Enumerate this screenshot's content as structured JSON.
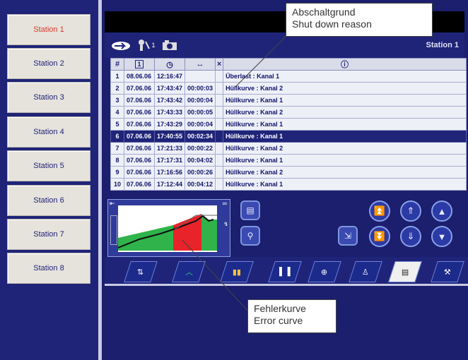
{
  "sidebar": {
    "stations": [
      "Station 1",
      "Station 2",
      "Station 3",
      "Station 4",
      "Station 5",
      "Station 6",
      "Station 7",
      "Station 8"
    ]
  },
  "header": {
    "station_label": "Station 1",
    "superscript": "1"
  },
  "table": {
    "columns": [
      "#",
      "1",
      "clock",
      "↔",
      "×",
      "ⓘ"
    ],
    "rows": [
      {
        "no": "1",
        "date": "08.06.06",
        "time": "12:16:47",
        "dur": "",
        "reason": "Überlast : Kanal 1"
      },
      {
        "no": "2",
        "date": "07.06.06",
        "time": "17:43:47",
        "dur": "00:00:03",
        "reason": "Hüllkurve : Kanal 2"
      },
      {
        "no": "3",
        "date": "07.06.06",
        "time": "17:43:42",
        "dur": "00:00:04",
        "reason": "Hüllkurve : Kanal 1"
      },
      {
        "no": "4",
        "date": "07.06.06",
        "time": "17:43:33",
        "dur": "00:00:05",
        "reason": "Hüllkurve : Kanal 2"
      },
      {
        "no": "5",
        "date": "07.06.06",
        "time": "17:43:29",
        "dur": "00:00:04",
        "reason": "Hüllkurve : Kanal 1"
      },
      {
        "no": "6",
        "date": "07.06.06",
        "time": "17:40:55",
        "dur": "00:02:34",
        "reason": "Hüllkurve : Kanal 1"
      },
      {
        "no": "7",
        "date": "07.06.06",
        "time": "17:21:33",
        "dur": "00:00:22",
        "reason": "Hüllkurve : Kanal 2"
      },
      {
        "no": "8",
        "date": "07.06.06",
        "time": "17:17:31",
        "dur": "00:04:02",
        "reason": "Hüllkurve : Kanal 1"
      },
      {
        "no": "9",
        "date": "07.06.06",
        "time": "17:16:56",
        "dur": "00:00:26",
        "reason": "Hüllkurve : Kanal 2"
      },
      {
        "no": "10",
        "date": "07.06.06",
        "time": "17:12:44",
        "dur": "00:04:12",
        "reason": "Hüllkurve : Kanal 1"
      }
    ],
    "selected_row": 6
  },
  "callouts": {
    "top": [
      "Abschaltgrund",
      "Shut down reason"
    ],
    "bottom": [
      "Fehlerkurve",
      "Error curve"
    ]
  },
  "icons": [
    "cloud-arrow-icon",
    "wrench-person-icon",
    "camera-icon"
  ],
  "colors": {
    "accent": "#1f2478",
    "error": "#e8232a",
    "ok": "#2fb34a"
  }
}
